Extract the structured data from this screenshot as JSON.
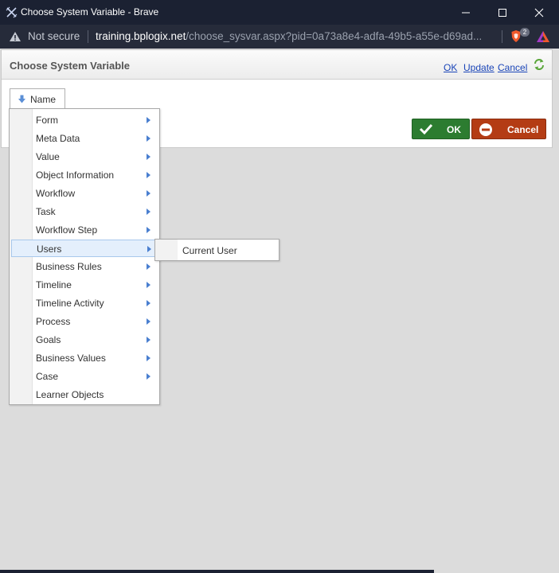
{
  "window": {
    "title": "Choose System Variable - Brave",
    "minimize_icon": "minimize-icon",
    "maximize_icon": "maximize-icon",
    "close_icon": "close-icon"
  },
  "address_bar": {
    "security_label": "Not secure",
    "host": "training.bplogix.net",
    "path": "/choose_sysvar.aspx?pid=0a73a8e4-adfa-49b5-a55e-d69ad...",
    "shields_count": "2"
  },
  "panel": {
    "title": "Choose System Variable",
    "links": {
      "ok": "OK",
      "update": "Update",
      "cancel": "Cancel"
    },
    "name_tab": "Name",
    "ok_button": "OK",
    "cancel_button": "Cancel"
  },
  "menu": {
    "items": [
      {
        "label": "Form",
        "submenu": true
      },
      {
        "label": "Meta Data",
        "submenu": true
      },
      {
        "label": "Value",
        "submenu": true
      },
      {
        "label": "Object Information",
        "submenu": true
      },
      {
        "label": "Workflow",
        "submenu": true
      },
      {
        "label": "Task",
        "submenu": true
      },
      {
        "label": "Workflow Step",
        "submenu": true
      },
      {
        "label": "Users",
        "submenu": true,
        "active": true
      },
      {
        "label": "Business Rules",
        "submenu": true
      },
      {
        "label": "Timeline",
        "submenu": true
      },
      {
        "label": "Timeline Activity",
        "submenu": true
      },
      {
        "label": "Process",
        "submenu": true
      },
      {
        "label": "Goals",
        "submenu": true
      },
      {
        "label": "Business Values",
        "submenu": true
      },
      {
        "label": "Case",
        "submenu": true
      },
      {
        "label": "Learner Objects",
        "submenu": false
      }
    ],
    "submenu_items": [
      {
        "label": "Current User"
      }
    ]
  },
  "colors": {
    "titlebar": "#1b2132",
    "ok_green": "#2c7c30",
    "cancel_red": "#b43c14",
    "link_blue": "#1a45b8"
  }
}
